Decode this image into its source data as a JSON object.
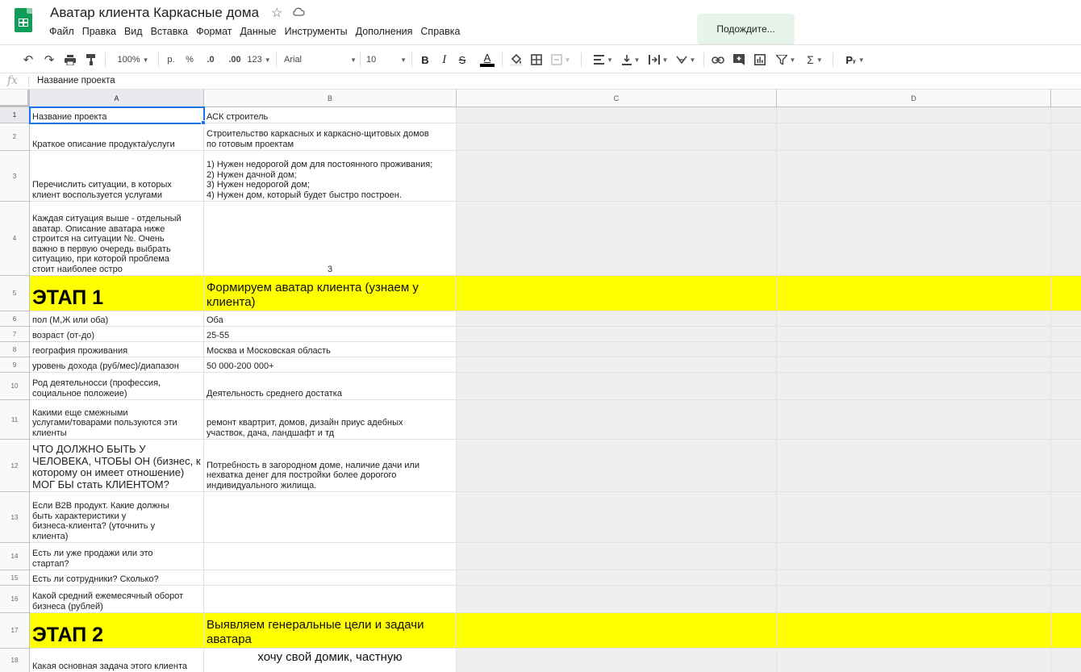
{
  "app": {
    "doc_title": "Аватар клиента Каркасные дома",
    "wait_toast": "Подождите...",
    "menu": [
      "Файл",
      "Правка",
      "Вид",
      "Вставка",
      "Формат",
      "Данные",
      "Инструменты",
      "Дополнения",
      "Справка"
    ]
  },
  "toolbar": {
    "zoom": "100%",
    "currency": "р.",
    "percent": "%",
    "dec_decrease": ".0",
    "dec_increase": ".00",
    "format_more": "123",
    "font": "Arial",
    "font_size": "10"
  },
  "formula_bar": {
    "fx": "fx",
    "value": "Название проекта"
  },
  "columns": [
    "A",
    "B",
    "C",
    "D"
  ],
  "rows": [
    {
      "num": "1",
      "a": "Название проекта",
      "b": "АСК строитель"
    },
    {
      "num": "2",
      "a": "Краткое описание продукта/услуги",
      "b": "Строительство каркасных и каркасно-щитовых домов\nпо готовым проектам"
    },
    {
      "num": "3",
      "a": "Перечислить ситуации, в которых\nклиент воспользуется услугами",
      "b": "1) Нужен недорогой дом для постоянного проживания;\n2) Нужен дачной дом;\n3) Нужен недорогой дом;\n4) Нужен дом, который будет быстро построен."
    },
    {
      "num": "4",
      "a": "Каждая ситуация выше - отдельный\nаватар. Описание аватара ниже\nстроится на ситуации №. Очень\nважно в первую очередь выбрать\nситуацию, при которой проблема\nстоит наиболее остро",
      "b": "3"
    },
    {
      "num": "5",
      "a": "ЭТАП 1",
      "b": "Формируем аватар клиента (узнаем у\nклиента)"
    },
    {
      "num": "6",
      "a": "пол (М,Ж или  оба)",
      "b": "Оба"
    },
    {
      "num": "7",
      "a": "возраст (от-до)",
      "b": "25-55"
    },
    {
      "num": "8",
      "a": "география проживания",
      "b": "Москва и Московская область"
    },
    {
      "num": "9",
      "a": "уровень дохода (руб/мес)/диапазон",
      "b": "50 000-200 000+"
    },
    {
      "num": "10",
      "a": "Род деятельносси (профессия,\nсоциальное положеие)",
      "b": "Деятельность среднего достатка"
    },
    {
      "num": "11",
      "a": "Какими еще смежными\nуслугами/товарами  пользуются эти\nклиенты",
      "b": "ремонт квартрит, домов, дизайн приус адебных\nучаствок, дача, ландшафт и тд"
    },
    {
      "num": "12",
      "a": "ЧТО ДОЛЖНО БЫТЬ У\nЧЕЛОВЕКА, ЧТОБЫ ОН (бизнес, к\nкоторому он имеет отношение)\nМОГ БЫ стать  КЛИЕНТОМ?",
      "b": "Потребность в загородном доме, наличие дачи или\nнехватка денег для постройки более дорогого\nиндивидуального жилища."
    },
    {
      "num": "13",
      "a": "Если  B2B продукт. Какие должны\nбыть характеристики у\nбизнеса-клиента? (уточнить у\nклиента)",
      "b": ""
    },
    {
      "num": "14",
      "a": "Есть ли уже продажи или это\nстартап?",
      "b": ""
    },
    {
      "num": "15",
      "a": "Есть ли сотрудники? Сколько?",
      "b": ""
    },
    {
      "num": "16",
      "a": "Какой средний ежемесячный оборот\nбизнеса (рублей)",
      "b": ""
    },
    {
      "num": "17",
      "a": "ЭТАП 2",
      "b": "Выявляем генеральные цели и задачи\nаватара"
    },
    {
      "num": "18",
      "a": "Какая основная задача этого клиента",
      "b": "хочу свой домик, частную"
    }
  ]
}
